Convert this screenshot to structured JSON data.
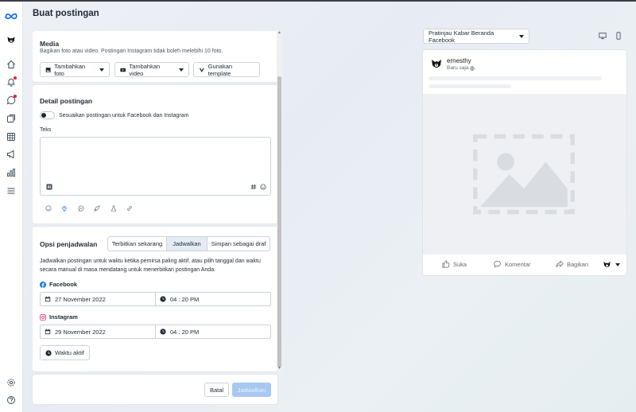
{
  "page": {
    "title": "Buat postingan"
  },
  "colors": {
    "accent": "#1877f2",
    "notification": "#e41e3f",
    "disabled_button": "#a6c8f2",
    "dark_text": "#1c2b33"
  },
  "rail": {
    "logo": "meta-logo-icon",
    "items": [
      "avatar",
      "home-icon",
      "notifications-icon",
      "messages-icon",
      "content-icon",
      "calendar-icon",
      "ads-icon",
      "insights-icon",
      "menu-icon"
    ],
    "bottom": [
      "settings-icon",
      "help-icon"
    ]
  },
  "media": {
    "title": "Media",
    "description": "Bagikan foto atau video. Postingan Instagram tidak boleh melebihi 10 foto.",
    "add_photo": "Tambahkan foto",
    "add_video": "Tambahkan video",
    "use_template": "Gunakan template"
  },
  "details": {
    "title": "Detail postingan",
    "customize_toggle_label": "Sesuaikan postingan untuk Facebook dan Instagram",
    "text_label": "Teks",
    "text_value": ""
  },
  "scheduling": {
    "title": "Opsi penjadwalan",
    "tabs": [
      "Terbitkan sekarang",
      "Jadwalkan",
      "Simpan sebagai draf"
    ],
    "active_tab": "Jadwalkan",
    "description": "Jadwalkan postingan untuk waktu ketika pemirsa paling aktif, atau pilih tanggal dan waktu secara manual di masa mendatang untuk menerbitkan postingan Anda.",
    "facebook": {
      "label": "Facebook",
      "date": "27 November 2022",
      "time": "04 : 20 PM"
    },
    "instagram": {
      "label": "Instagram",
      "date": "29 November 2022",
      "time": "04 : 20 PM"
    },
    "active_times_button": "Waktu aktif"
  },
  "footer": {
    "cancel": "Batal",
    "schedule": "Jadwalkan"
  },
  "preview": {
    "selector": "Pratinjau Kabar Beranda Facebook",
    "account_name": "ernesthy",
    "timestamp": "Baru saja",
    "actions": {
      "like": "Suka",
      "comment": "Komentar",
      "share": "Bagikan"
    }
  }
}
